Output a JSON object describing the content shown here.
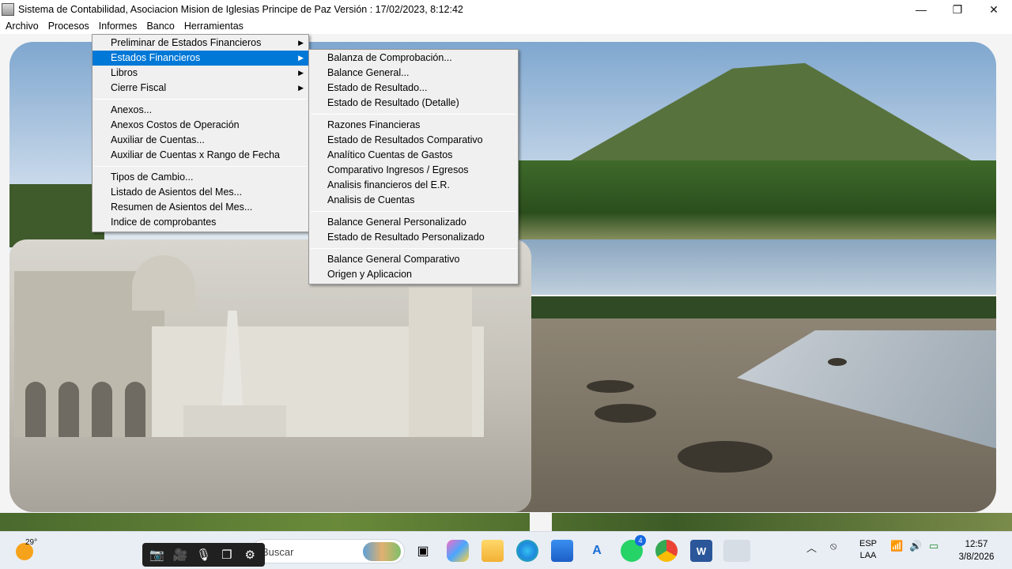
{
  "window": {
    "title": "Sistema de Contabilidad, Asociacion Mision de Iglesias Principe de Paz  Versión : 17/02/2023,  8:12:42",
    "controls": {
      "minimize": "—",
      "maximize": "❐",
      "close": "✕"
    }
  },
  "menubar": {
    "items": [
      "Archivo",
      "Procesos",
      "Informes",
      "Banco",
      "Herramientas"
    ]
  },
  "informes_menu": {
    "items": [
      {
        "label": "Preliminar de Estados Financieros",
        "submenu": true
      },
      {
        "label": "Estados Financieros",
        "submenu": true,
        "highlighted": true
      },
      {
        "label": "Libros",
        "submenu": true
      },
      {
        "label": "Cierre Fiscal",
        "submenu": true
      },
      {
        "label": "Anexos..."
      },
      {
        "label": "Anexos Costos de Operación"
      },
      {
        "label": "Auxiliar de Cuentas..."
      },
      {
        "label": "Auxiliar de Cuentas x Rango de Fecha"
      },
      {
        "label": "Tipos de Cambio..."
      },
      {
        "label": "Listado de Asientos del Mes..."
      },
      {
        "label": "Resumen de Asientos del Mes..."
      },
      {
        "label": "Indice de comprobantes"
      }
    ]
  },
  "estados_menu": {
    "items": [
      "Balanza de Comprobación...",
      "Balance General...",
      "Estado de Resultado...",
      "Estado de Resultado (Detalle)",
      "Razones Financieras",
      "Estado de Resultados Comparativo",
      "Analítico Cuentas de Gastos",
      "Comparativo Ingresos / Egresos",
      "Analisis financieros del E.R.",
      "Analisis de Cuentas",
      "Balance General Personalizado",
      "Estado de Resultado Personalizado",
      "Balance General Comparativo",
      "Origen y Aplicacion"
    ]
  },
  "taskbar": {
    "weather_temp": "29°",
    "search_placeholder": "Buscar",
    "whatsapp_badge": "4",
    "language": "ESP",
    "keyboard": "LAA",
    "time": "12:57",
    "date": "3/8/2026"
  },
  "colors": {
    "menu_highlight": "#0078d7",
    "menu_background": "#f0f0f0",
    "taskbar": "#e9eef4"
  }
}
